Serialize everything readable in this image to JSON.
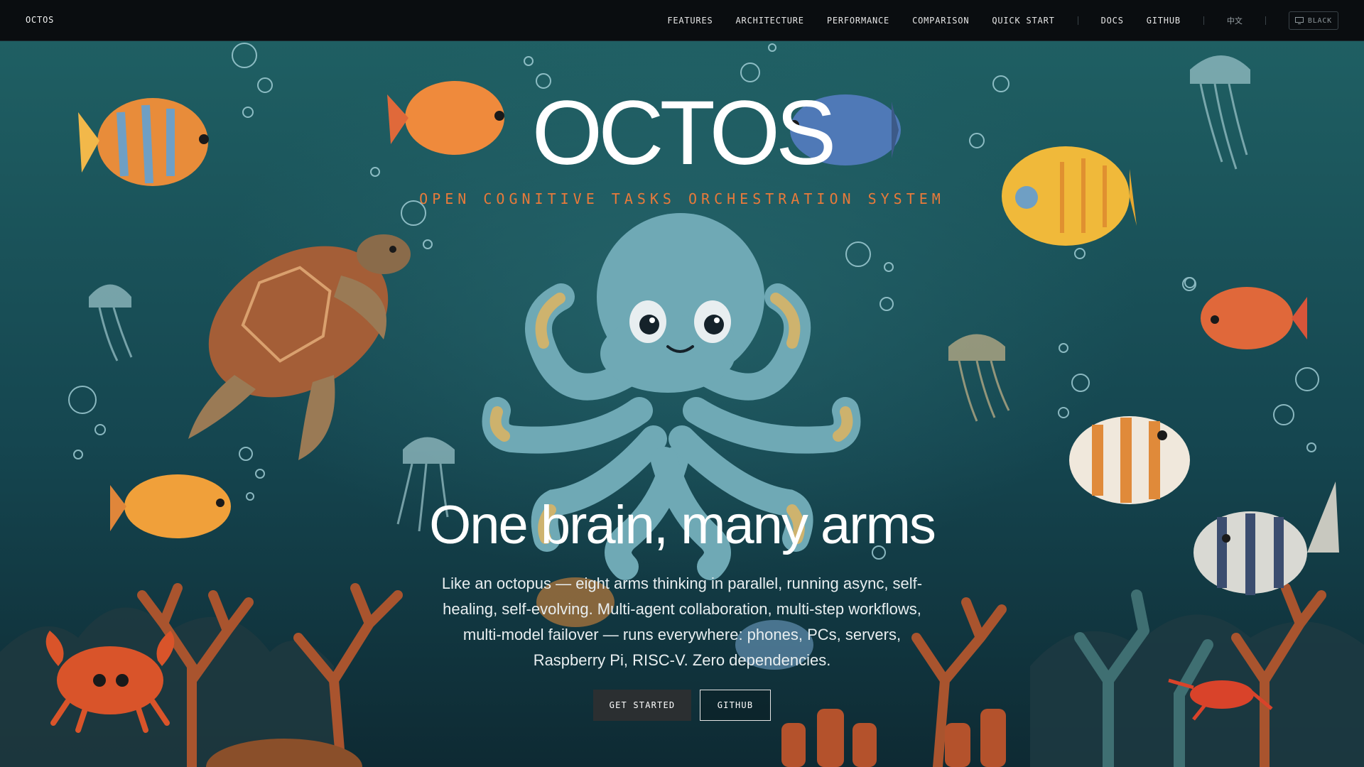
{
  "nav": {
    "brand": "OCTOS",
    "links": [
      "FEATURES",
      "ARCHITECTURE",
      "PERFORMANCE",
      "COMPARISON",
      "QUICK START"
    ],
    "docs": "DOCS",
    "github": "GITHUB",
    "language": "中文",
    "theme_label": "BLACK"
  },
  "hero": {
    "title": "OCTOS",
    "subtitle": "OPEN COGNITIVE TASKS ORCHESTRATION SYSTEM",
    "headline": "One brain, many arms",
    "description": "Like an octopus — eight arms thinking in parallel, running async, self-healing, self-evolving. Multi-agent collaboration, multi-step workflows, multi-model failover — runs everywhere: phones, PCs, servers, Raspberry Pi, RISC-V. Zero dependencies.",
    "primary_button": "GET STARTED",
    "secondary_button": "GITHUB"
  },
  "colors": {
    "nav_bg": "#0a0d10",
    "ocean_top": "#1f5f63",
    "ocean_bottom": "#0e2a33",
    "accent_orange": "#e87a3a",
    "octopus": "#6fa9b5"
  },
  "illustration": {
    "icons": [
      "octopus-illustration",
      "sea-turtle-illustration",
      "fish-illustration",
      "jellyfish-illustration",
      "crab-illustration",
      "coral-illustration",
      "bubbles-illustration"
    ]
  }
}
